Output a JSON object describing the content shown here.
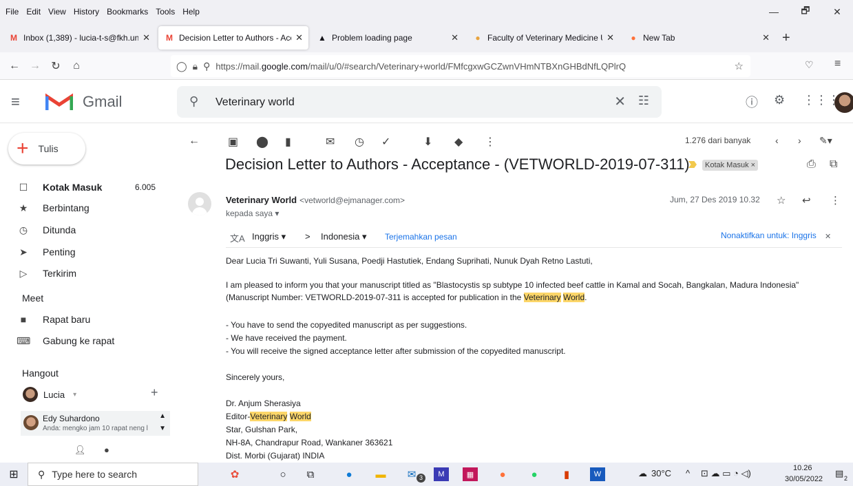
{
  "menubar": {
    "items": [
      "File",
      "Edit",
      "View",
      "History",
      "Bookmarks",
      "Tools",
      "Help"
    ],
    "minimize": "—",
    "restore": "🗗",
    "close": "✕"
  },
  "tabs": [
    {
      "label": "Inbox (1,389) - lucia-t-s@fkh.un",
      "icon": "gmail-icon",
      "close": "✕"
    },
    {
      "label": "Decision Letter to Authors - Acc",
      "icon": "gmail-icon",
      "close": "✕"
    },
    {
      "label": "Problem loading page",
      "icon": "warning-icon",
      "close": "✕"
    },
    {
      "label": "Faculty of Veterinary Medicine U",
      "icon": "globe-icon",
      "close": "✕"
    },
    {
      "label": "New Tab",
      "icon": "firefox-icon",
      "close": "✕"
    }
  ],
  "new_tab": "+",
  "nav": {
    "url_prefix": "https://mail.",
    "url_host": "google.com",
    "url_rest": "/mail/u/0/#search/Veterinary+world/FMfcgxwGCZwnVHmNTBXnGHBdNfLQPlrQ"
  },
  "gmail": {
    "logo_text": "Gmail",
    "search_value": "Veterinary world",
    "compose": "Tulis",
    "sidebar": [
      {
        "label": "Kotak Masuk",
        "count": "6.005",
        "icon": "inbox-icon"
      },
      {
        "label": "Berbintang",
        "icon": "star-icon"
      },
      {
        "label": "Ditunda",
        "icon": "clock-icon"
      },
      {
        "label": "Penting",
        "icon": "important-icon"
      },
      {
        "label": "Terkirim",
        "icon": "send-icon"
      }
    ],
    "meet_title": "Meet",
    "meet_items": [
      {
        "label": "Rapat baru",
        "icon": "video-icon"
      },
      {
        "label": "Gabung ke rapat",
        "icon": "keyboard-icon"
      }
    ],
    "hangout_title": "Hangout",
    "hangout_user": "Lucia",
    "chat": {
      "name": "Edy Suhardono",
      "message": "Anda: mengko jam 10 rapat neng l"
    }
  },
  "message": {
    "paging": "1.276 dari banyak",
    "subject": "Decision Letter to Authors - Acceptance - (VETWORLD-2019-07-311)",
    "label": "Kotak Masuk ×",
    "sender_name": "Veterinary World",
    "sender_email": "<vetworld@ejmanager.com>",
    "to": "kepada saya ▾",
    "date": "Jum, 27 Des 2019 10.32",
    "translate": {
      "from": "Inggris ▾",
      "arrow": ">",
      "to": "Indonesia ▾",
      "action": "Terjemahkan pesan",
      "disable": "Nonaktifkan untuk: Inggris"
    },
    "greeting": "Dear Lucia Tri Suwanti, Yuli Susana, Poedji Hastutiek, Endang Suprihati, Nunuk Dyah Retno Lastuti,",
    "para1_line1": "I am pleased to inform you that your manuscript titled as \"Blastocystis sp subtype 10 infected beef cattle in Kamal and Socah, Bangkalan, Madura Indonesia\"",
    "para1_line2_a": "(Manuscript Number: VETWORLD-2019-07-311 is accepted for publication in the ",
    "para1_line2_hl1": "Veterinary",
    "para1_line2_hl2": "World",
    "para1_line2_end": ".",
    "bullet1": "- You have to send the copyedited manuscript as per suggestions.",
    "bullet2": "- We have received the payment.",
    "bullet3": "- You will receive the signed acceptance letter after submission of the copyedited manuscript.",
    "closing": "Sincerely yours,",
    "sig_name": "Dr. Anjum Sherasiya",
    "sig_title_a": "Editor-",
    "sig_title_hl1": "Veterinary",
    "sig_title_hl2": "World",
    "sig_addr1": "Star, Gulshan Park,",
    "sig_addr2": "NH-8A, Chandrapur Road, Wankaner 363621",
    "sig_addr3": "Dist. Morbi (Gujarat) INDIA"
  },
  "taskbar": {
    "search_placeholder": "Type here to search",
    "temperature": "30°C",
    "time": "10.26",
    "date": "30/05/2022",
    "notif_count": "2",
    "mail_badge": "3"
  },
  "colors": {
    "gmail_red": "#ea4335",
    "link_blue": "#1a73e8",
    "highlight": "#fcd669"
  }
}
